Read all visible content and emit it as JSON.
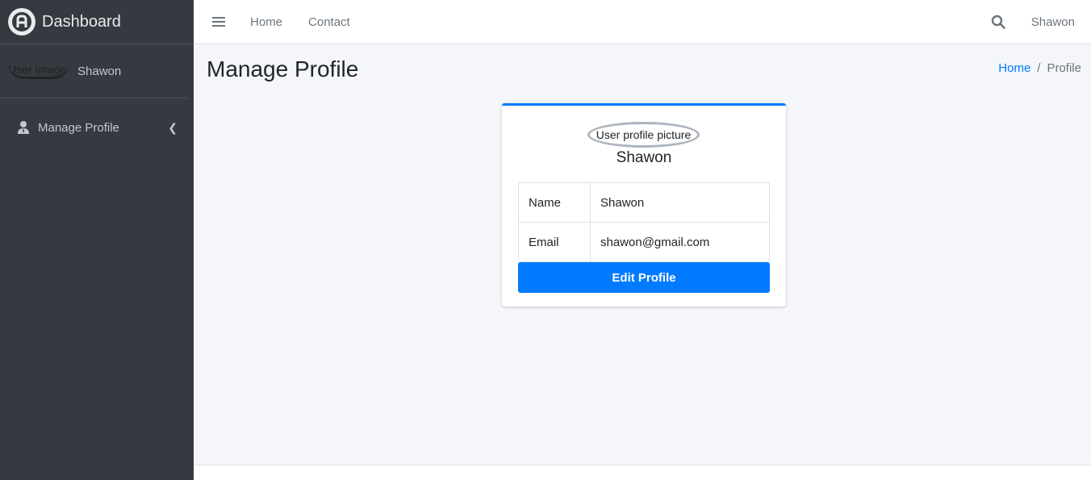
{
  "brand": {
    "title": "Dashboard"
  },
  "user_panel": {
    "image_alt": "User Image",
    "name": "Shawon"
  },
  "sidebar": {
    "items": [
      {
        "label": "Manage Profile",
        "icon": "user-tie-icon"
      }
    ]
  },
  "topbar": {
    "links": [
      "Home",
      "Contact"
    ],
    "user": "Shawon"
  },
  "page": {
    "title": "Manage Profile"
  },
  "breadcrumb": {
    "home": "Home",
    "sep": "/",
    "current": "Profile"
  },
  "profile": {
    "picture_alt": "User profile picture",
    "name": "Shawon",
    "rows": [
      {
        "key": "Name",
        "value": "Shawon"
      },
      {
        "key": "Email",
        "value": "shawon@gmail.com"
      }
    ],
    "edit_label": "Edit Profile"
  },
  "colors": {
    "sidebar": "#343a40",
    "accent": "#007bff",
    "background": "#f4f6f9"
  }
}
